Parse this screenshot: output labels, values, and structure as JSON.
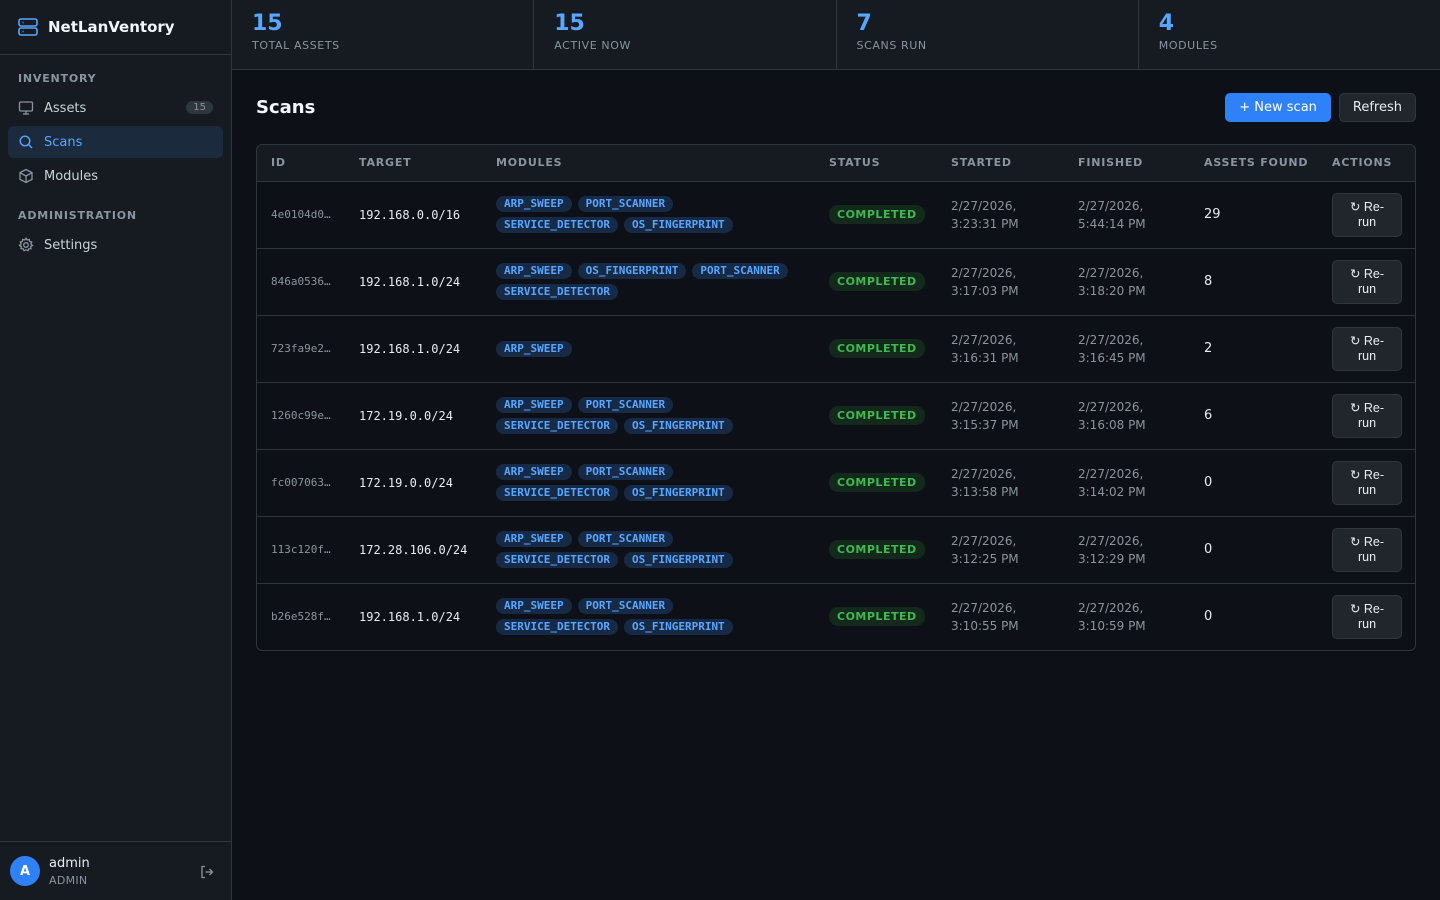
{
  "app": {
    "name": "NetLanVentory"
  },
  "sidebar": {
    "sections": [
      {
        "label": "INVENTORY"
      },
      {
        "label": "ADMINISTRATION"
      }
    ],
    "items": [
      {
        "label": "Assets",
        "badge": "15",
        "icon": "monitor-icon"
      },
      {
        "label": "Scans",
        "icon": "search-icon",
        "active": true
      },
      {
        "label": "Modules",
        "icon": "cube-icon"
      },
      {
        "label": "Settings",
        "icon": "gear-icon"
      }
    ],
    "user": {
      "initial": "A",
      "name": "admin",
      "role": "ADMIN"
    }
  },
  "stats": [
    {
      "value": "15",
      "label": "TOTAL ASSETS"
    },
    {
      "value": "15",
      "label": "ACTIVE NOW"
    },
    {
      "value": "7",
      "label": "SCANS RUN"
    },
    {
      "value": "4",
      "label": "MODULES"
    }
  ],
  "page": {
    "title": "Scans",
    "new_scan_label": "+ New scan",
    "refresh_label": "Refresh"
  },
  "table": {
    "columns": [
      "ID",
      "TARGET",
      "MODULES",
      "STATUS",
      "STARTED",
      "FINISHED",
      "ASSETS FOUND",
      "ACTIONS"
    ],
    "rerun_label": "↻ Re-\nrun",
    "rows": [
      {
        "id": "4e0104d0…",
        "target": "192.168.0.0/16",
        "modules": [
          "ARP_SWEEP",
          "PORT_SCANNER",
          "SERVICE_DETECTOR",
          "OS_FINGERPRINT"
        ],
        "status": "COMPLETED",
        "started": [
          "2/27/2026,",
          "3:23:31 PM"
        ],
        "finished": [
          "2/27/2026,",
          "5:44:14 PM"
        ],
        "found": "29"
      },
      {
        "id": "846a0536…",
        "target": "192.168.1.0/24",
        "modules": [
          "ARP_SWEEP",
          "OS_FINGERPRINT",
          "PORT_SCANNER",
          "SERVICE_DETECTOR"
        ],
        "status": "COMPLETED",
        "started": [
          "2/27/2026,",
          "3:17:03 PM"
        ],
        "finished": [
          "2/27/2026,",
          "3:18:20 PM"
        ],
        "found": "8"
      },
      {
        "id": "723fa9e2…",
        "target": "192.168.1.0/24",
        "modules": [
          "ARP_SWEEP"
        ],
        "status": "COMPLETED",
        "started": [
          "2/27/2026,",
          "3:16:31 PM"
        ],
        "finished": [
          "2/27/2026,",
          "3:16:45 PM"
        ],
        "found": "2"
      },
      {
        "id": "1260c99e…",
        "target": "172.19.0.0/24",
        "modules": [
          "ARP_SWEEP",
          "PORT_SCANNER",
          "SERVICE_DETECTOR",
          "OS_FINGERPRINT"
        ],
        "status": "COMPLETED",
        "started": [
          "2/27/2026,",
          "3:15:37 PM"
        ],
        "finished": [
          "2/27/2026,",
          "3:16:08 PM"
        ],
        "found": "6"
      },
      {
        "id": "fc007063…",
        "target": "172.19.0.0/24",
        "modules": [
          "ARP_SWEEP",
          "PORT_SCANNER",
          "SERVICE_DETECTOR",
          "OS_FINGERPRINT"
        ],
        "status": "COMPLETED",
        "started": [
          "2/27/2026,",
          "3:13:58 PM"
        ],
        "finished": [
          "2/27/2026,",
          "3:14:02 PM"
        ],
        "found": "0"
      },
      {
        "id": "113c120f…",
        "target": "172.28.106.0/24",
        "modules": [
          "ARP_SWEEP",
          "PORT_SCANNER",
          "SERVICE_DETECTOR",
          "OS_FINGERPRINT"
        ],
        "status": "COMPLETED",
        "started": [
          "2/27/2026,",
          "3:12:25 PM"
        ],
        "finished": [
          "2/27/2026,",
          "3:12:29 PM"
        ],
        "found": "0"
      },
      {
        "id": "b26e528f…",
        "target": "192.168.1.0/24",
        "modules": [
          "ARP_SWEEP",
          "PORT_SCANNER",
          "SERVICE_DETECTOR",
          "OS_FINGERPRINT"
        ],
        "status": "COMPLETED",
        "started": [
          "2/27/2026,",
          "3:10:55 PM"
        ],
        "finished": [
          "2/27/2026,",
          "3:10:59 PM"
        ],
        "found": "0"
      }
    ]
  },
  "colors": {
    "accent": "#2f81f7",
    "success": "#3fb950",
    "background": "#0d1117",
    "panel": "#161b22"
  }
}
